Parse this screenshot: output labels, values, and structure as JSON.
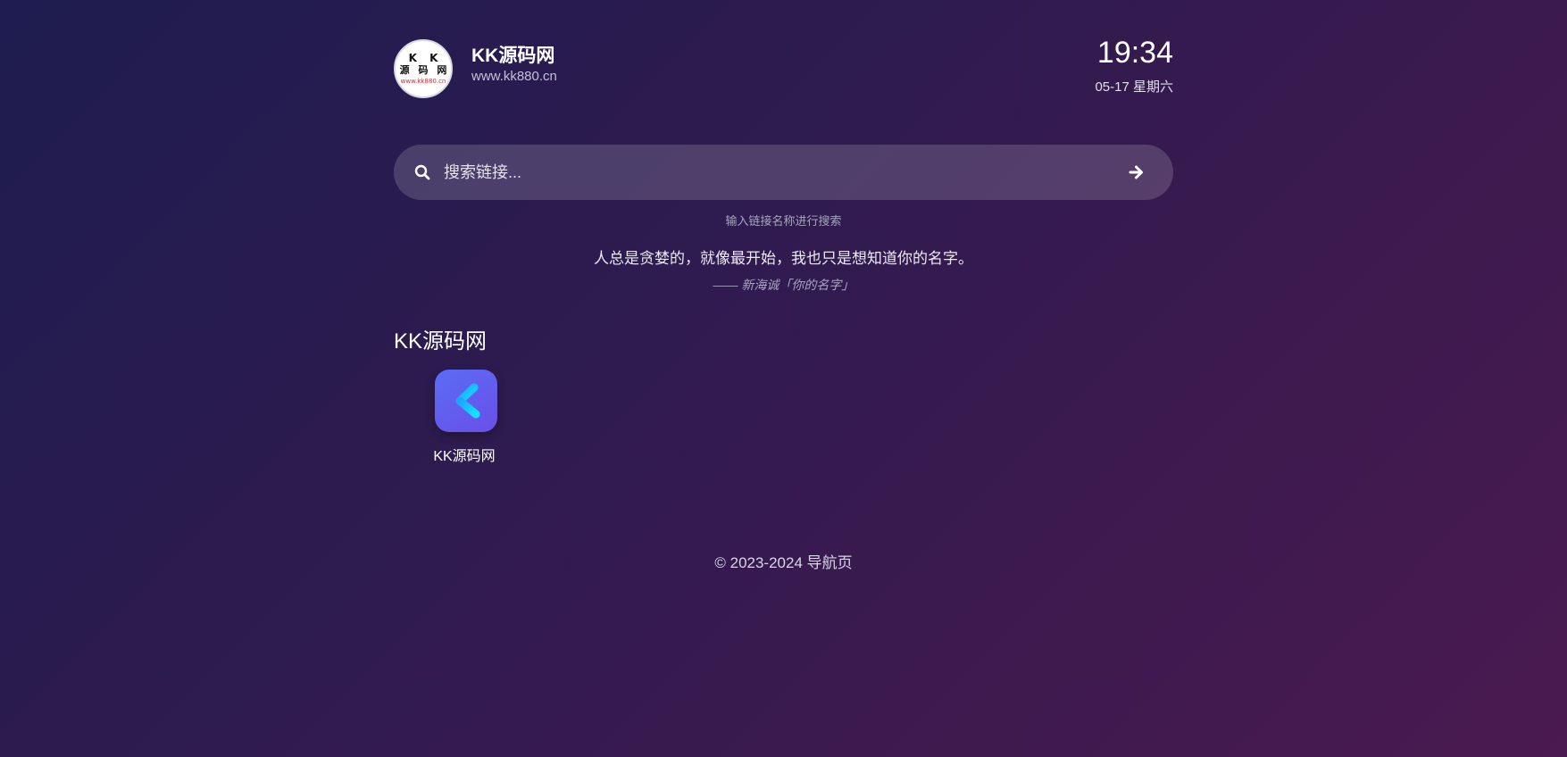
{
  "header": {
    "logo": {
      "line1": "K K",
      "line2": "源 码 网",
      "line3": "www.kk880.cn"
    },
    "site_name": "KK源码网",
    "site_url": "www.kk880.cn",
    "time": "19:34",
    "date": "05-17 星期六"
  },
  "search": {
    "placeholder": "搜索链接...",
    "value": "",
    "hint": "输入链接名称进行搜索"
  },
  "quote": {
    "text": "人总是贪婪的，就像最开始，我也只是想知道你的名字。",
    "source": "—— 新海诚「你的名字」"
  },
  "categories": [
    {
      "title": "KK源码网",
      "links": [
        {
          "label": "KK源码网",
          "icon": "kk-app-icon"
        }
      ]
    }
  ],
  "footer": {
    "copyright": "© 2023-2024 导航页"
  },
  "colors": {
    "background_start": "#1e1c50",
    "background_end": "#4a1a50",
    "app_icon": "#5b6cf5",
    "logo_url_text": "#d92a3a"
  }
}
